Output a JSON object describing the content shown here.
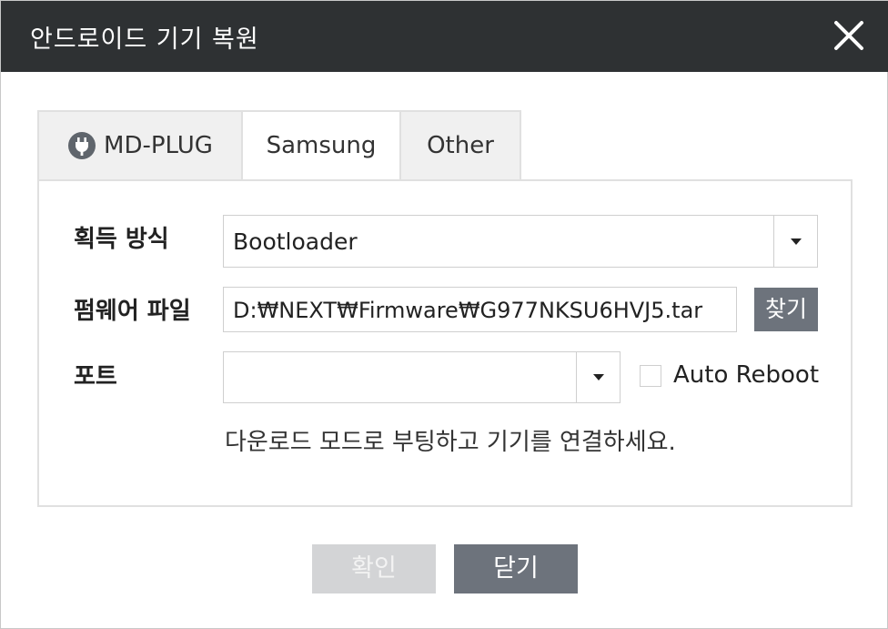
{
  "window": {
    "title": "안드로이드 기기 복원",
    "close_icon": "close-icon"
  },
  "tabs": [
    {
      "label": "MD-PLUG",
      "icon": "plug-icon",
      "active": false
    },
    {
      "label": "Samsung",
      "active": true
    },
    {
      "label": "Other",
      "active": false
    }
  ],
  "form": {
    "acquisition_label": "획득 방식",
    "acquisition_value": "Bootloader",
    "firmware_label": "펌웨어 파일",
    "firmware_value": "D:₩NEXT₩Firmware₩G977NKSU6HVJ5.tar",
    "browse_label": "찾기",
    "port_label": "포트",
    "port_value": "",
    "auto_reboot_label": "Auto Reboot",
    "auto_reboot_checked": false,
    "hint": "다운로드 모드로 부팅하고 기기를 연결하세요."
  },
  "buttons": {
    "ok_label": "확인",
    "ok_enabled": false,
    "close_label": "닫기"
  },
  "colors": {
    "titlebar": "#2e3133",
    "button_dark": "#6d737c",
    "button_disabled": "#d3d4d6"
  }
}
